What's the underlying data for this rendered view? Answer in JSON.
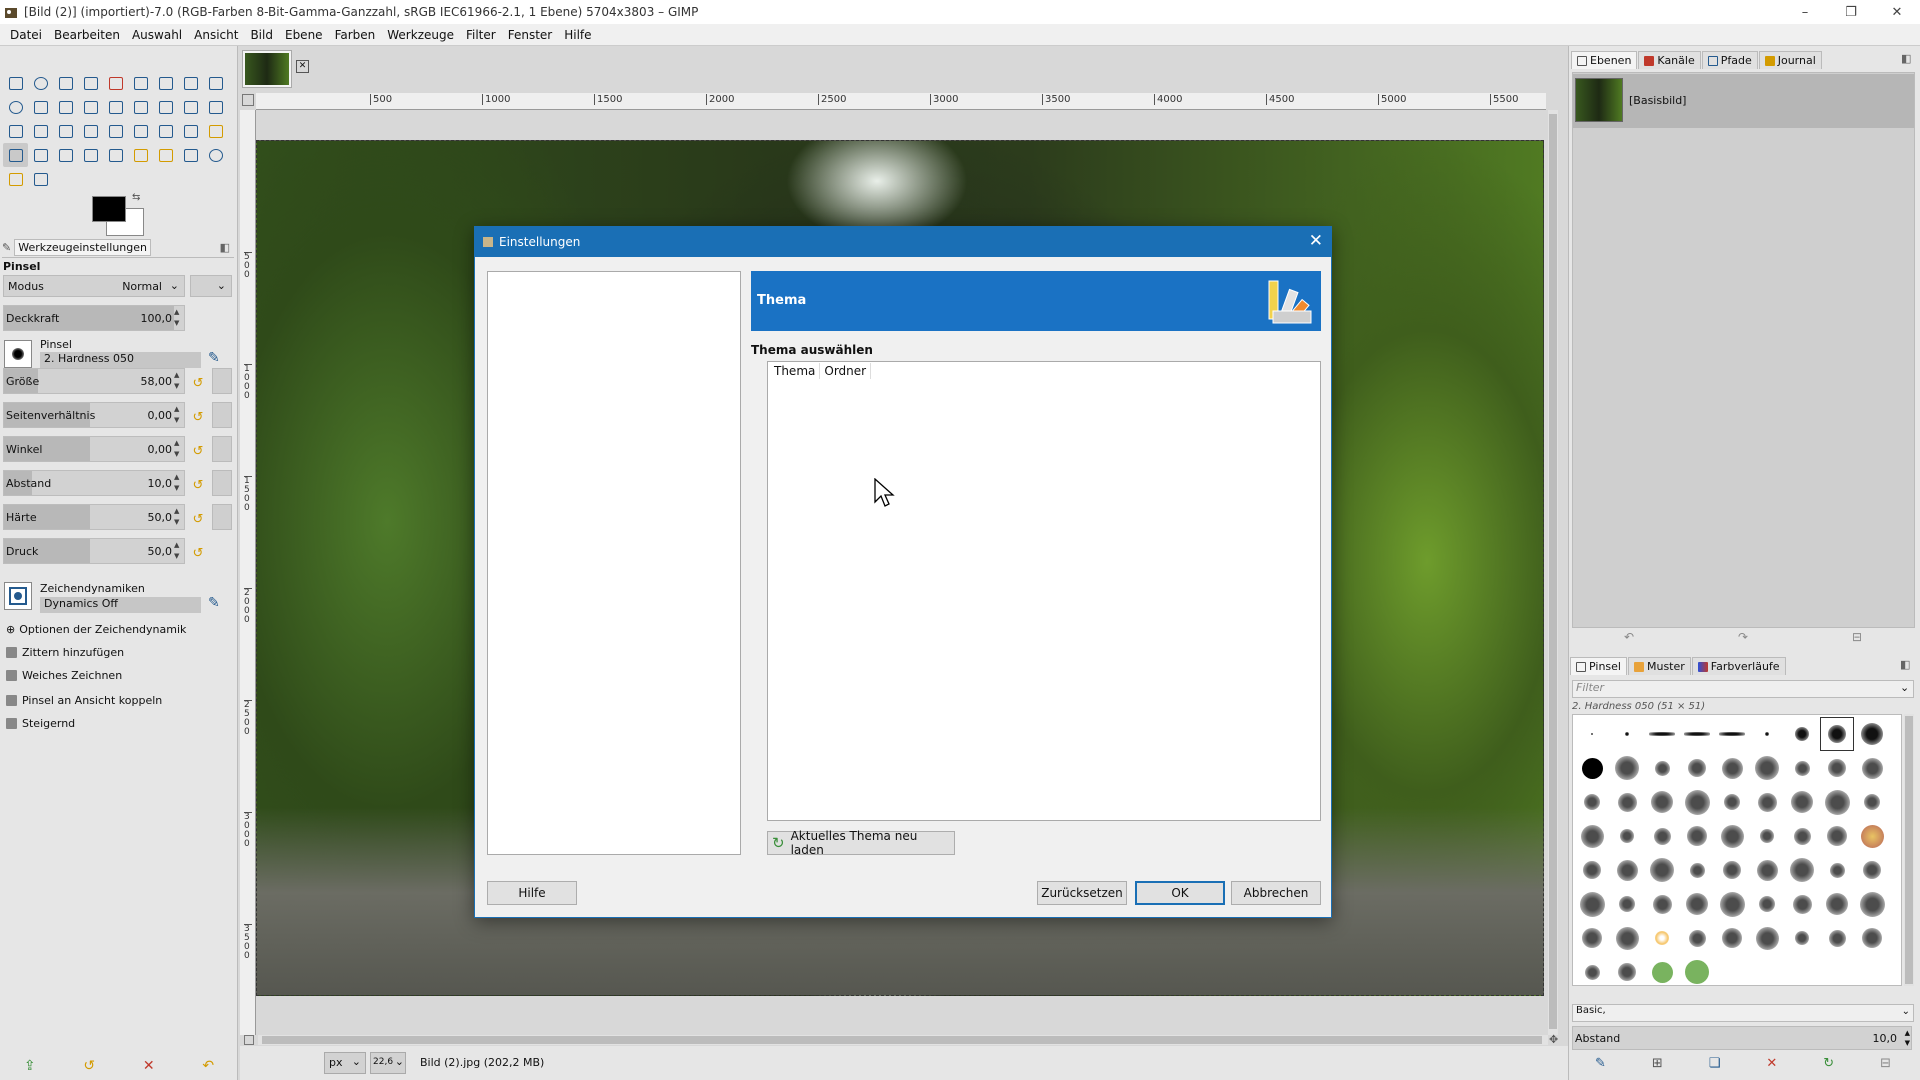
{
  "window": {
    "title": "[Bild (2)] (importiert)-7.0 (RGB-Farben 8-Bit-Gamma-Ganzzahl, sRGB IEC61966-2.1, 1 Ebene) 5704x3803 – GIMP",
    "minimize_glyph": "–",
    "restore_glyph": "❐",
    "close_glyph": "✕"
  },
  "menu": [
    "Datei",
    "Bearbeiten",
    "Auswahl",
    "Ansicht",
    "Bild",
    "Ebene",
    "Farben",
    "Werkzeuge",
    "Filter",
    "Fenster",
    "Hilfe"
  ],
  "tool_options": {
    "tab_label": "Werkzeugeinstellungen",
    "tool_name": "Pinsel",
    "mode_label": "Modus",
    "mode_value": "Normal",
    "opacity_label": "Deckkraft",
    "opacity_value": "100,0",
    "brush_label": "Pinsel",
    "brush_value": "2. Hardness 050",
    "size": {
      "label": "Größe",
      "value": "58,00"
    },
    "aspect": {
      "label": "Seitenverhältnis",
      "value": "0,00"
    },
    "angle": {
      "label": "Winkel",
      "value": "0,00"
    },
    "spacing": {
      "label": "Abstand",
      "value": "10,0"
    },
    "hardness": {
      "label": "Härte",
      "value": "50,0"
    },
    "force": {
      "label": "Druck",
      "value": "50,0"
    },
    "dynamics_label": "Zeichendynamiken",
    "dynamics_value": "Dynamics Off",
    "checkbox_dynamics_options": "Optionen der Zeichendynamik",
    "checkbox_jitter": "Zittern hinzufügen",
    "checkbox_smooth": "Weiches Zeichnen",
    "checkbox_lock_view": "Pinsel an Ansicht koppeln",
    "checkbox_incremental": "Steigernd"
  },
  "ruler": {
    "h_ticks": [
      "500",
      "1000",
      "1500",
      "2000",
      "2500",
      "3000",
      "3500",
      "4000",
      "4500",
      "5000",
      "5500"
    ],
    "v_ticks": [
      "500",
      "1000",
      "1500",
      "2000",
      "2500",
      "3000",
      "3500"
    ]
  },
  "statusbar": {
    "unit": "px",
    "zoom": "22,6",
    "info": "Bild (2).jpg (202,2 MB)"
  },
  "layers_panel": {
    "tabs": [
      "Ebenen",
      "Kanäle",
      "Pfade",
      "Journal"
    ],
    "layer_name": "[Basisbild]"
  },
  "brushes_panel": {
    "tabs": [
      "Pinsel",
      "Muster",
      "Farbverläufe"
    ],
    "filter_placeholder": "Filter",
    "selected_brush": "2. Hardness 050 (51 × 51)",
    "tag_value": "Basic,",
    "spacing_label": "Abstand",
    "spacing_value": "10,0"
  },
  "dialog": {
    "title": "Einstellungen",
    "banner_title": "Thema",
    "section_title": "Thema auswählen",
    "col_theme": "Thema",
    "col_folder": "Ordner",
    "reload_button": "Aktuelles Thema neu laden",
    "help_button": "Hilfe",
    "reset_button": "Zurücksetzen",
    "ok_button": "OK",
    "cancel_button": "Abbrechen"
  },
  "colors": {
    "accent": "#1a6fb5",
    "banner": "#1a72c4",
    "foreground": "#000000",
    "background": "#ffffff"
  }
}
